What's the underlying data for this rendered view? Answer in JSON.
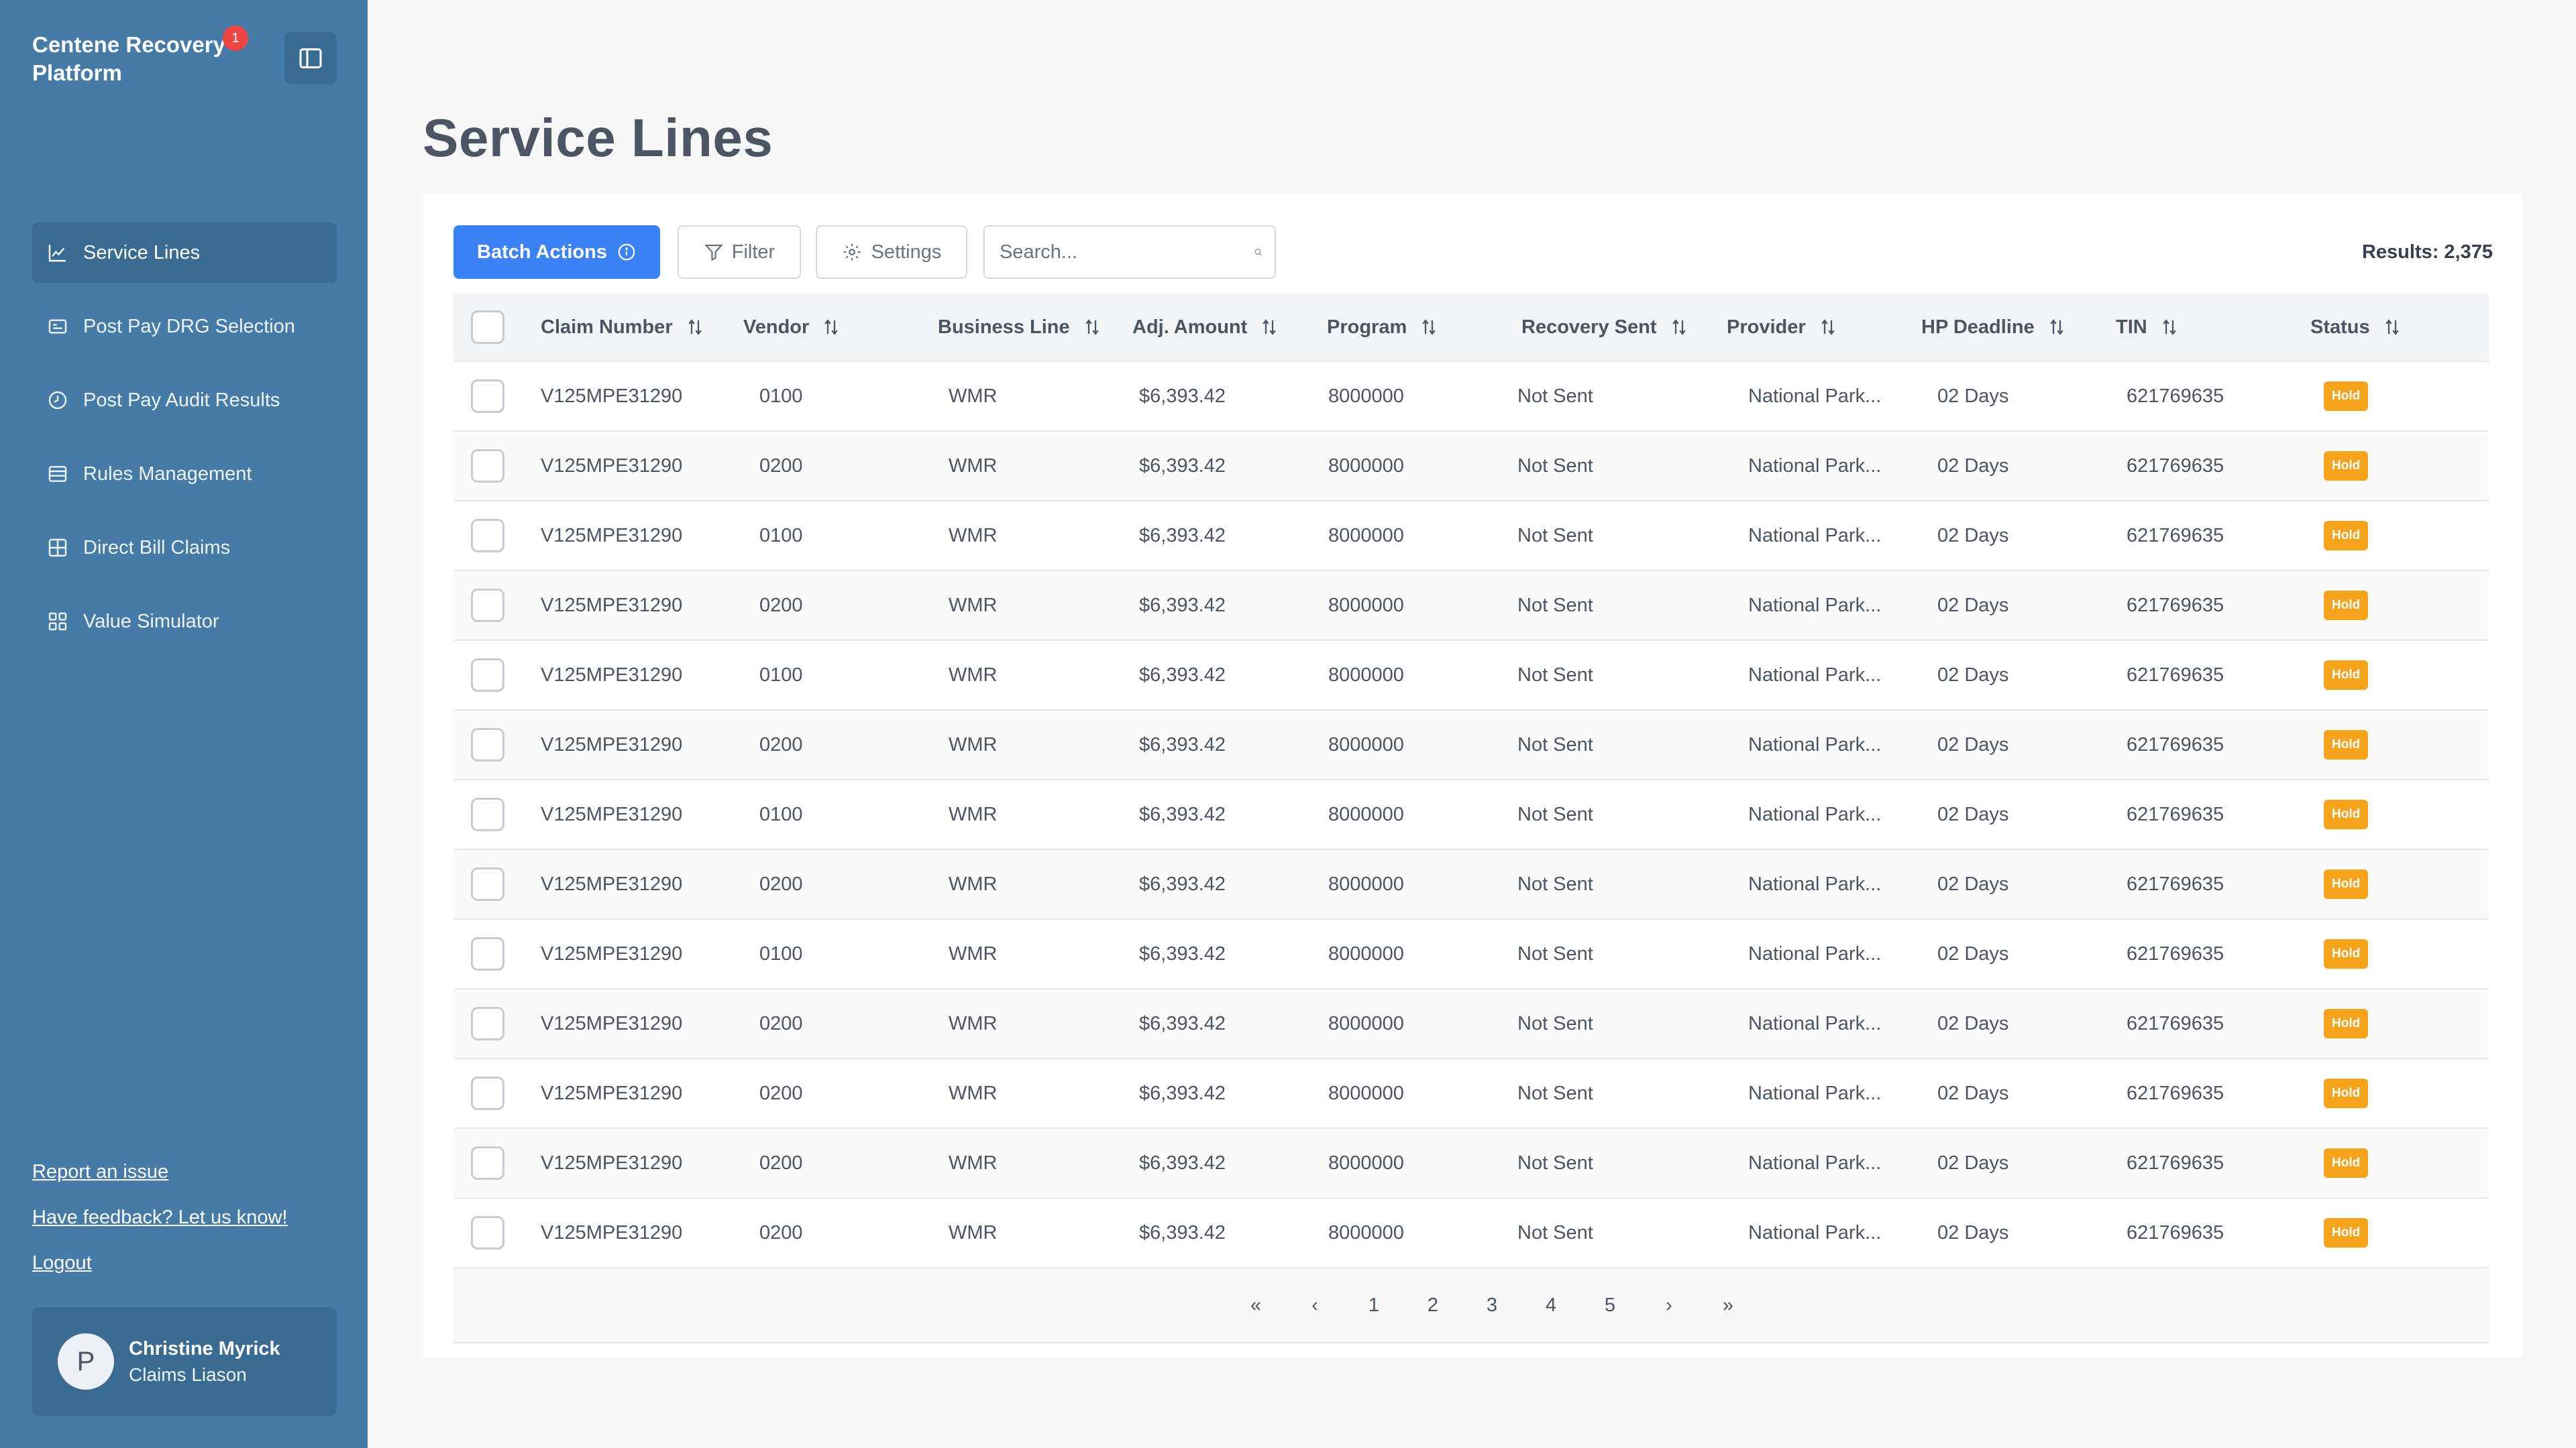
{
  "app": {
    "title": "Centene Recovery Platform",
    "notification_count": "1"
  },
  "sidebar": {
    "items": [
      {
        "label": "Service Lines",
        "icon": "chart-line-icon",
        "active": true
      },
      {
        "label": "Post Pay DRG Selection",
        "icon": "id-card-icon",
        "active": false
      },
      {
        "label": "Post Pay Audit Results",
        "icon": "clock-icon",
        "active": false
      },
      {
        "label": "Rules Management",
        "icon": "list-icon",
        "active": false
      },
      {
        "label": "Direct Bill Claims",
        "icon": "grid-icon",
        "active": false
      },
      {
        "label": "Value Simulator",
        "icon": "apps-icon",
        "active": false
      }
    ],
    "links": {
      "report": "Report an issue",
      "feedback": "Have feedback? Let us know!",
      "logout": "Logout"
    },
    "user": {
      "initial": "P",
      "name": "Christine Myrick",
      "role": "Claims Liason"
    }
  },
  "page": {
    "title": "Service Lines"
  },
  "toolbar": {
    "batch_actions": "Batch Actions",
    "filter": "Filter",
    "settings": "Settings",
    "search_placeholder": "Search...",
    "results": "Results: 2,375"
  },
  "table": {
    "columns": [
      "Claim Number",
      "Vendor",
      "Business Line",
      "Adj. Amount",
      "Program",
      "Recovery Sent",
      "Provider",
      "HP Deadline",
      "TIN",
      "Status"
    ],
    "rows": [
      [
        "V125MPE31290",
        "0100",
        "WMR",
        "$6,393.42",
        "8000000",
        "Not Sent",
        "National Park...",
        "02 Days",
        "621769635",
        "Hold"
      ],
      [
        "V125MPE31290",
        "0200",
        "WMR",
        "$6,393.42",
        "8000000",
        "Not Sent",
        "National Park...",
        "02 Days",
        "621769635",
        "Hold"
      ],
      [
        "V125MPE31290",
        "0100",
        "WMR",
        "$6,393.42",
        "8000000",
        "Not Sent",
        "National Park...",
        "02 Days",
        "621769635",
        "Hold"
      ],
      [
        "V125MPE31290",
        "0200",
        "WMR",
        "$6,393.42",
        "8000000",
        "Not Sent",
        "National Park...",
        "02 Days",
        "621769635",
        "Hold"
      ],
      [
        "V125MPE31290",
        "0100",
        "WMR",
        "$6,393.42",
        "8000000",
        "Not Sent",
        "National Park...",
        "02 Days",
        "621769635",
        "Hold"
      ],
      [
        "V125MPE31290",
        "0200",
        "WMR",
        "$6,393.42",
        "8000000",
        "Not Sent",
        "National Park...",
        "02 Days",
        "621769635",
        "Hold"
      ],
      [
        "V125MPE31290",
        "0100",
        "WMR",
        "$6,393.42",
        "8000000",
        "Not Sent",
        "National Park...",
        "02 Days",
        "621769635",
        "Hold"
      ],
      [
        "V125MPE31290",
        "0200",
        "WMR",
        "$6,393.42",
        "8000000",
        "Not Sent",
        "National Park...",
        "02 Days",
        "621769635",
        "Hold"
      ],
      [
        "V125MPE31290",
        "0100",
        "WMR",
        "$6,393.42",
        "8000000",
        "Not Sent",
        "National Park...",
        "02 Days",
        "621769635",
        "Hold"
      ],
      [
        "V125MPE31290",
        "0200",
        "WMR",
        "$6,393.42",
        "8000000",
        "Not Sent",
        "National Park...",
        "02 Days",
        "621769635",
        "Hold"
      ],
      [
        "V125MPE31290",
        "0200",
        "WMR",
        "$6,393.42",
        "8000000",
        "Not Sent",
        "National Park...",
        "02 Days",
        "621769635",
        "Hold"
      ],
      [
        "V125MPE31290",
        "0200",
        "WMR",
        "$6,393.42",
        "8000000",
        "Not Sent",
        "National Park...",
        "02 Days",
        "621769635",
        "Hold"
      ],
      [
        "V125MPE31290",
        "0200",
        "WMR",
        "$6,393.42",
        "8000000",
        "Not Sent",
        "National Park...",
        "02 Days",
        "621769635",
        "Hold"
      ]
    ]
  },
  "pagination": {
    "pages": [
      "1",
      "2",
      "3",
      "4",
      "5"
    ],
    "first": "«",
    "prev": "‹",
    "next": "›",
    "last": "»"
  },
  "colors": {
    "sidebar_bg": "#457ba6",
    "primary": "#3b82f6",
    "hold_badge": "#f5a31a",
    "notification": "#ef4444"
  }
}
